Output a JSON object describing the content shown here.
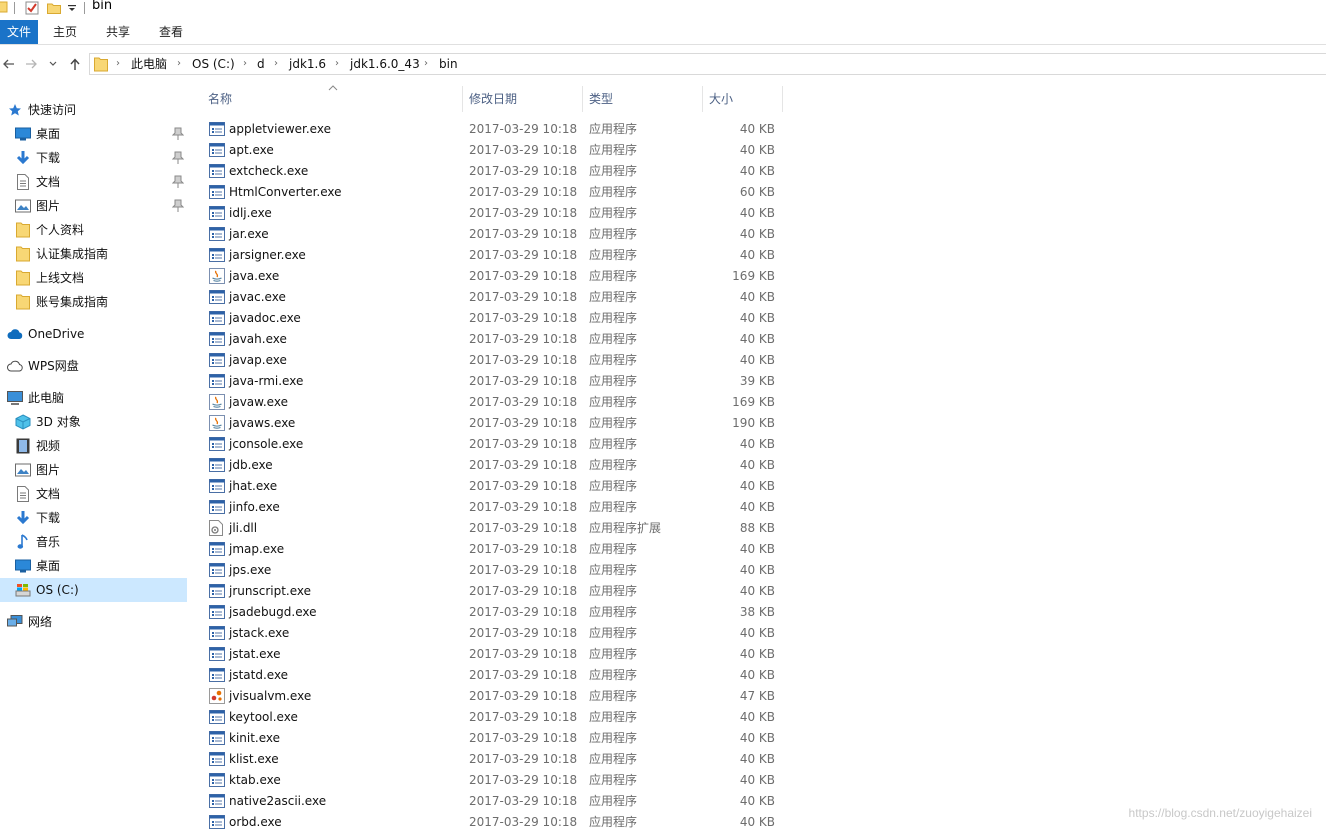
{
  "window": {
    "title": "bin"
  },
  "ribbon": {
    "tabs": [
      "文件",
      "主页",
      "共享",
      "查看"
    ]
  },
  "address": {
    "crumbs": [
      "此电脑",
      "OS (C:)",
      "d",
      "jdk1.6",
      "jdk1.6.0_43",
      "bin"
    ]
  },
  "sidebar": {
    "items": [
      {
        "label": "快速访问",
        "icon": "star-icon",
        "pinned": false,
        "selected": false
      },
      {
        "label": "桌面",
        "icon": "desktop-icon",
        "pinned": true,
        "selected": false
      },
      {
        "label": "下载",
        "icon": "download-icon",
        "pinned": true,
        "selected": false
      },
      {
        "label": "文档",
        "icon": "document-icon",
        "pinned": true,
        "selected": false
      },
      {
        "label": "图片",
        "icon": "pictures-icon",
        "pinned": true,
        "selected": false
      },
      {
        "label": "个人资料",
        "icon": "folder-icon",
        "pinned": false,
        "selected": false
      },
      {
        "label": "认证集成指南",
        "icon": "folder-icon",
        "pinned": false,
        "selected": false
      },
      {
        "label": "上线文档",
        "icon": "folder-icon",
        "pinned": false,
        "selected": false
      },
      {
        "label": "账号集成指南",
        "icon": "folder-icon",
        "pinned": false,
        "selected": false
      },
      {
        "label": "OneDrive",
        "icon": "cloud-icon",
        "pinned": false,
        "selected": false
      },
      {
        "label": "WPS网盘",
        "icon": "wps-cloud-icon",
        "pinned": false,
        "selected": false
      },
      {
        "label": "此电脑",
        "icon": "computer-icon",
        "pinned": false,
        "selected": false
      },
      {
        "label": "3D 对象",
        "icon": "3d-objects-icon",
        "pinned": false,
        "selected": false
      },
      {
        "label": "视频",
        "icon": "video-icon",
        "pinned": false,
        "selected": false
      },
      {
        "label": "图片",
        "icon": "pictures-icon",
        "pinned": false,
        "selected": false
      },
      {
        "label": "文档",
        "icon": "document-icon",
        "pinned": false,
        "selected": false
      },
      {
        "label": "下载",
        "icon": "download-icon",
        "pinned": false,
        "selected": false
      },
      {
        "label": "音乐",
        "icon": "music-icon",
        "pinned": false,
        "selected": false
      },
      {
        "label": "桌面",
        "icon": "desktop-icon",
        "pinned": false,
        "selected": false
      },
      {
        "label": "OS (C:)",
        "icon": "drive-icon",
        "pinned": false,
        "selected": true
      },
      {
        "label": "网络",
        "icon": "network-icon",
        "pinned": false,
        "selected": false
      }
    ]
  },
  "columns": {
    "name": "名称",
    "date": "修改日期",
    "type": "类型",
    "size": "大小"
  },
  "files": [
    {
      "name": "appletviewer.exe",
      "date": "2017-03-29 10:18",
      "type": "应用程序",
      "size": "40 KB",
      "icon": "exe"
    },
    {
      "name": "apt.exe",
      "date": "2017-03-29 10:18",
      "type": "应用程序",
      "size": "40 KB",
      "icon": "exe"
    },
    {
      "name": "extcheck.exe",
      "date": "2017-03-29 10:18",
      "type": "应用程序",
      "size": "40 KB",
      "icon": "exe"
    },
    {
      "name": "HtmlConverter.exe",
      "date": "2017-03-29 10:18",
      "type": "应用程序",
      "size": "60 KB",
      "icon": "exe"
    },
    {
      "name": "idlj.exe",
      "date": "2017-03-29 10:18",
      "type": "应用程序",
      "size": "40 KB",
      "icon": "exe"
    },
    {
      "name": "jar.exe",
      "date": "2017-03-29 10:18",
      "type": "应用程序",
      "size": "40 KB",
      "icon": "exe"
    },
    {
      "name": "jarsigner.exe",
      "date": "2017-03-29 10:18",
      "type": "应用程序",
      "size": "40 KB",
      "icon": "exe"
    },
    {
      "name": "java.exe",
      "date": "2017-03-29 10:18",
      "type": "应用程序",
      "size": "169 KB",
      "icon": "java"
    },
    {
      "name": "javac.exe",
      "date": "2017-03-29 10:18",
      "type": "应用程序",
      "size": "40 KB",
      "icon": "exe"
    },
    {
      "name": "javadoc.exe",
      "date": "2017-03-29 10:18",
      "type": "应用程序",
      "size": "40 KB",
      "icon": "exe"
    },
    {
      "name": "javah.exe",
      "date": "2017-03-29 10:18",
      "type": "应用程序",
      "size": "40 KB",
      "icon": "exe"
    },
    {
      "name": "javap.exe",
      "date": "2017-03-29 10:18",
      "type": "应用程序",
      "size": "40 KB",
      "icon": "exe"
    },
    {
      "name": "java-rmi.exe",
      "date": "2017-03-29 10:18",
      "type": "应用程序",
      "size": "39 KB",
      "icon": "exe"
    },
    {
      "name": "javaw.exe",
      "date": "2017-03-29 10:18",
      "type": "应用程序",
      "size": "169 KB",
      "icon": "java"
    },
    {
      "name": "javaws.exe",
      "date": "2017-03-29 10:18",
      "type": "应用程序",
      "size": "190 KB",
      "icon": "java"
    },
    {
      "name": "jconsole.exe",
      "date": "2017-03-29 10:18",
      "type": "应用程序",
      "size": "40 KB",
      "icon": "exe"
    },
    {
      "name": "jdb.exe",
      "date": "2017-03-29 10:18",
      "type": "应用程序",
      "size": "40 KB",
      "icon": "exe"
    },
    {
      "name": "jhat.exe",
      "date": "2017-03-29 10:18",
      "type": "应用程序",
      "size": "40 KB",
      "icon": "exe"
    },
    {
      "name": "jinfo.exe",
      "date": "2017-03-29 10:18",
      "type": "应用程序",
      "size": "40 KB",
      "icon": "exe"
    },
    {
      "name": "jli.dll",
      "date": "2017-03-29 10:18",
      "type": "应用程序扩展",
      "size": "88 KB",
      "icon": "dll"
    },
    {
      "name": "jmap.exe",
      "date": "2017-03-29 10:18",
      "type": "应用程序",
      "size": "40 KB",
      "icon": "exe"
    },
    {
      "name": "jps.exe",
      "date": "2017-03-29 10:18",
      "type": "应用程序",
      "size": "40 KB",
      "icon": "exe"
    },
    {
      "name": "jrunscript.exe",
      "date": "2017-03-29 10:18",
      "type": "应用程序",
      "size": "40 KB",
      "icon": "exe"
    },
    {
      "name": "jsadebugd.exe",
      "date": "2017-03-29 10:18",
      "type": "应用程序",
      "size": "38 KB",
      "icon": "exe"
    },
    {
      "name": "jstack.exe",
      "date": "2017-03-29 10:18",
      "type": "应用程序",
      "size": "40 KB",
      "icon": "exe"
    },
    {
      "name": "jstat.exe",
      "date": "2017-03-29 10:18",
      "type": "应用程序",
      "size": "40 KB",
      "icon": "exe"
    },
    {
      "name": "jstatd.exe",
      "date": "2017-03-29 10:18",
      "type": "应用程序",
      "size": "40 KB",
      "icon": "exe"
    },
    {
      "name": "jvisualvm.exe",
      "date": "2017-03-29 10:18",
      "type": "应用程序",
      "size": "47 KB",
      "icon": "visualvm"
    },
    {
      "name": "keytool.exe",
      "date": "2017-03-29 10:18",
      "type": "应用程序",
      "size": "40 KB",
      "icon": "exe"
    },
    {
      "name": "kinit.exe",
      "date": "2017-03-29 10:18",
      "type": "应用程序",
      "size": "40 KB",
      "icon": "exe"
    },
    {
      "name": "klist.exe",
      "date": "2017-03-29 10:18",
      "type": "应用程序",
      "size": "40 KB",
      "icon": "exe"
    },
    {
      "name": "ktab.exe",
      "date": "2017-03-29 10:18",
      "type": "应用程序",
      "size": "40 KB",
      "icon": "exe"
    },
    {
      "name": "native2ascii.exe",
      "date": "2017-03-29 10:18",
      "type": "应用程序",
      "size": "40 KB",
      "icon": "exe"
    },
    {
      "name": "orbd.exe",
      "date": "2017-03-29 10:18",
      "type": "应用程序",
      "size": "40 KB",
      "icon": "exe"
    }
  ],
  "watermark": "https://blog.csdn.net/zuoyigehaizei",
  "colors": {
    "accent": "#1a73c8",
    "selection": "#cce8ff",
    "header_text": "#4d6185",
    "muted_text": "#6d6d6d",
    "folder": "#f8d775"
  }
}
